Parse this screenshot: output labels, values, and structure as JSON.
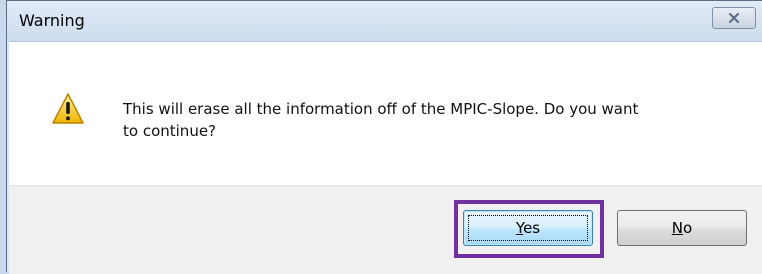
{
  "window": {
    "title": "Warning"
  },
  "message": {
    "line1": "This will erase all the information off of the MPIC-Slope. Do you want",
    "line2": "to continue?"
  },
  "buttons": {
    "yes": {
      "accel": "Y",
      "rest": "es"
    },
    "no": {
      "accel": "N",
      "rest": "o"
    }
  },
  "icons": {
    "close": "close-icon",
    "warning": "warning-icon"
  },
  "colors": {
    "highlight": "#7030a0",
    "warning_yellow": "#f5c400"
  }
}
